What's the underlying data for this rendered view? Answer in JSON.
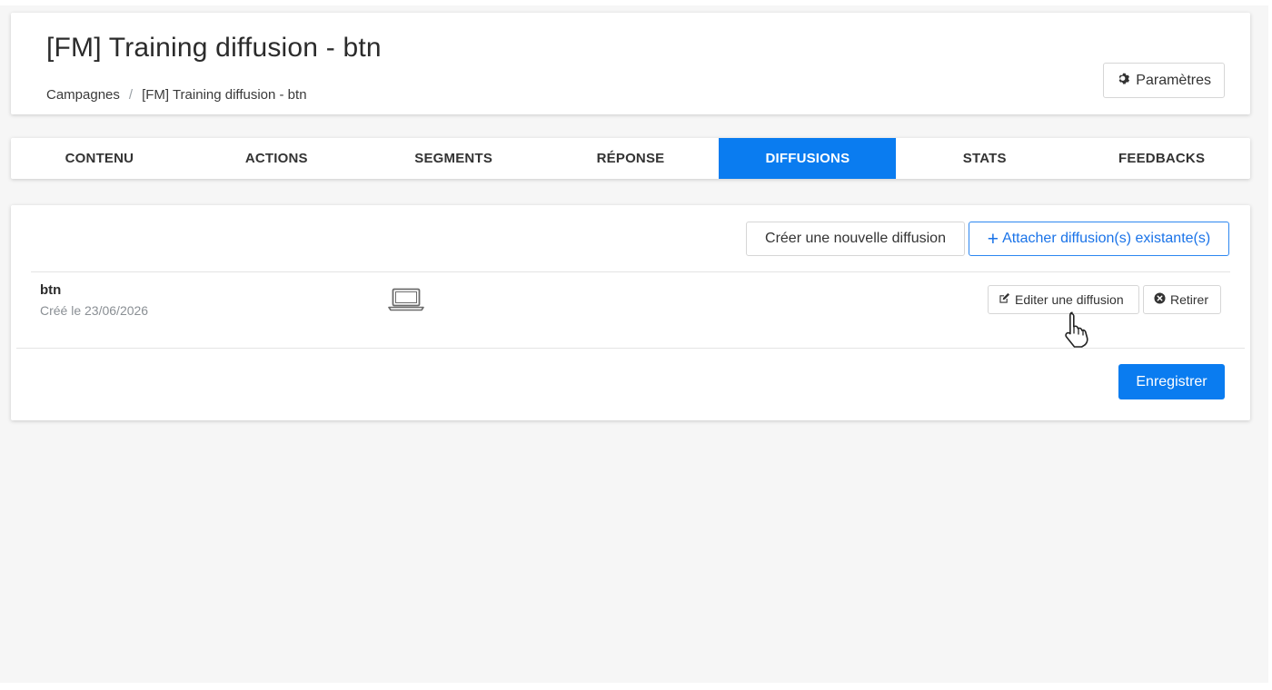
{
  "header": {
    "title": "[FM] Training diffusion - btn",
    "breadcrumb": {
      "root": "Campagnes",
      "separator": "/",
      "current": "[FM] Training diffusion - btn"
    },
    "settings_label": "Paramètres",
    "settings_icon": "gear-icon"
  },
  "tabs": [
    {
      "label": "CONTENU",
      "active": false
    },
    {
      "label": "ACTIONS",
      "active": false
    },
    {
      "label": "SEGMENTS",
      "active": false
    },
    {
      "label": "RÉPONSE",
      "active": false
    },
    {
      "label": "DIFFUSIONS",
      "active": true
    },
    {
      "label": "STATS",
      "active": false
    },
    {
      "label": "FEEDBACKS",
      "active": false
    }
  ],
  "toolbar": {
    "create_label": "Créer une nouvelle diffusion",
    "attach_plus": "+",
    "attach_label": "Attacher diffusion(s) existante(s)"
  },
  "diffusions": [
    {
      "name": "btn",
      "created": "Créé le 23/06/2026",
      "device_icon": "laptop-icon",
      "edit_label": "Editer une diffusion",
      "edit_icon": "edit-icon",
      "remove_label": "Retirer",
      "remove_icon": "remove-circle-icon"
    }
  ],
  "footer": {
    "save_label": "Enregistrer"
  },
  "colors": {
    "accent": "#0a7cf0",
    "page_background": "#f6f6f6",
    "card_background": "#ffffff"
  }
}
